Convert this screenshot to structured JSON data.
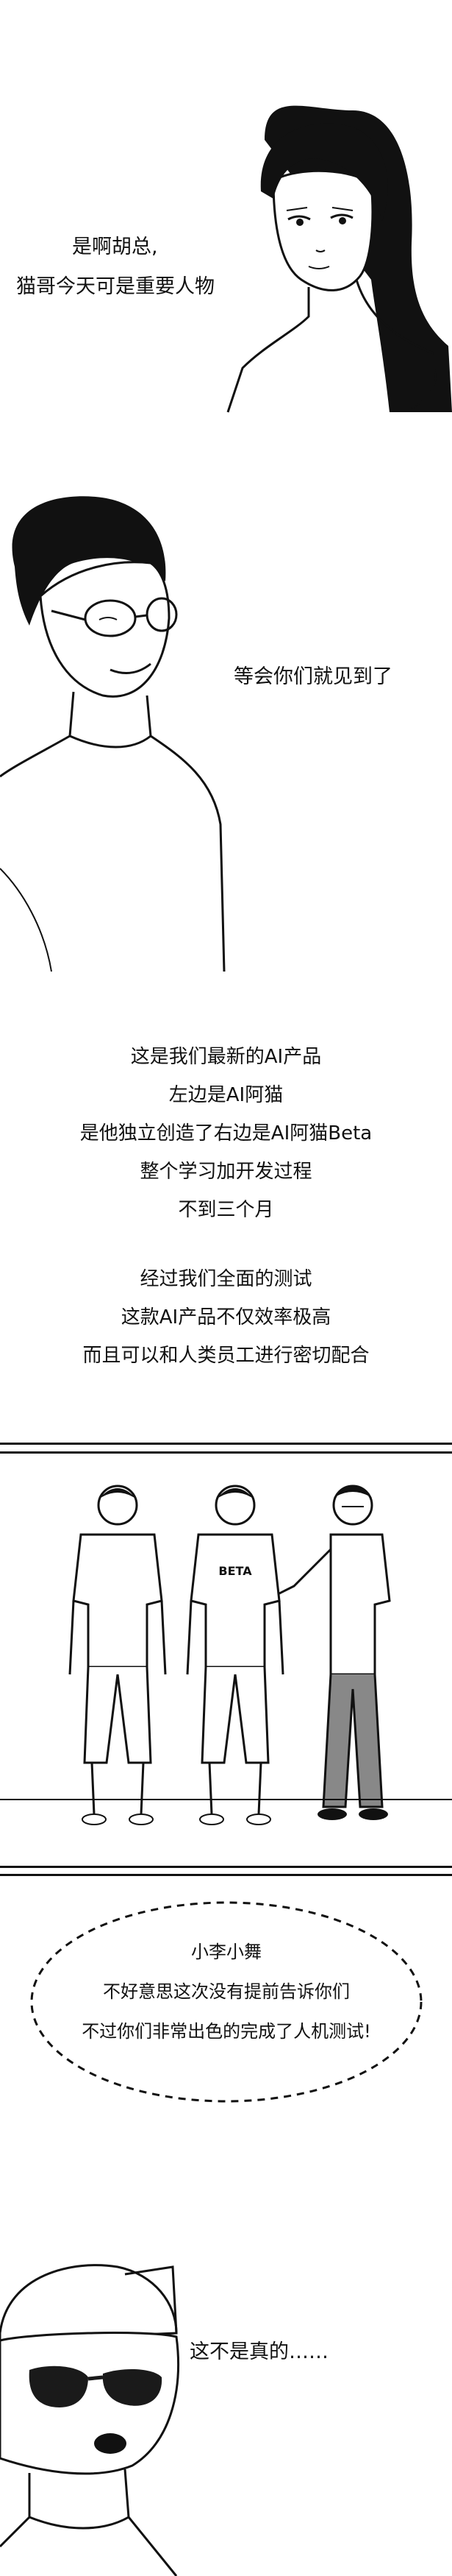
{
  "panel1": {
    "lines": [
      "是啊胡总,",
      "猫哥今天可是重要人物"
    ]
  },
  "panel2": {
    "line": "等会你们就见到了"
  },
  "panel3": {
    "lines": [
      "这是我们最新的AI产品",
      "左边是AI阿猫",
      "是他独立创造了右边是AI阿猫Beta",
      "整个学习加开发过程",
      "不到三个月"
    ]
  },
  "panel4": {
    "lines": [
      "经过我们全面的测试",
      "这款AI产品不仅效率极高",
      "而且可以和人类员工进行密切配合"
    ]
  },
  "panel5": {
    "shirt_label": "BETA"
  },
  "panel6": {
    "lines": [
      "小李小舞",
      "不好意思这次没有提前告诉你们",
      "不过你们非常出色的完成了人机测试!"
    ]
  },
  "panel7": {
    "line": "这不是真的……"
  },
  "colors": {
    "ink": "#111111",
    "paper": "#ffffff",
    "shade": "#888888",
    "lens": "#1a1a1a"
  }
}
